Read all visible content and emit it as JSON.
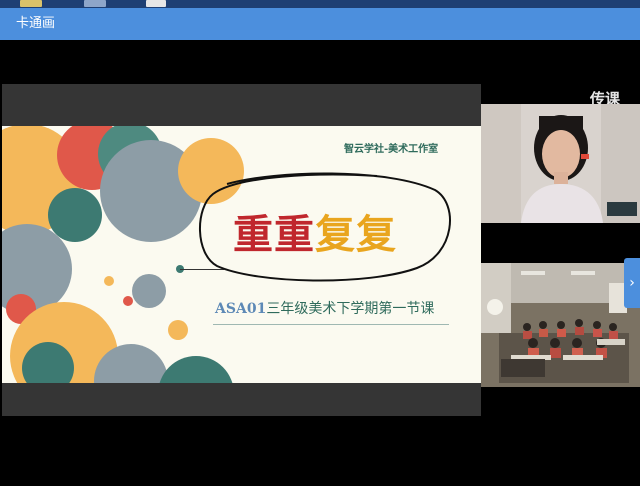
{
  "window": {
    "title": "卡通画"
  },
  "watermark": "传课",
  "slide": {
    "studio": "智云学社-美术工作室",
    "title_part1": "重重",
    "title_part2": "复复",
    "subtitle_code": "ASA01",
    "subtitle_text": "三年级美术下学期第一节课"
  },
  "colors": {
    "title_bar": "#4c8fdd",
    "title_red": "#c0272d",
    "title_gold": "#e9a51e",
    "teal": "#3d7a72",
    "orange": "#f4b85a",
    "gray": "#8d9da6",
    "red": "#e0584a"
  },
  "side_arrow_icon": "chevron-right-icon"
}
